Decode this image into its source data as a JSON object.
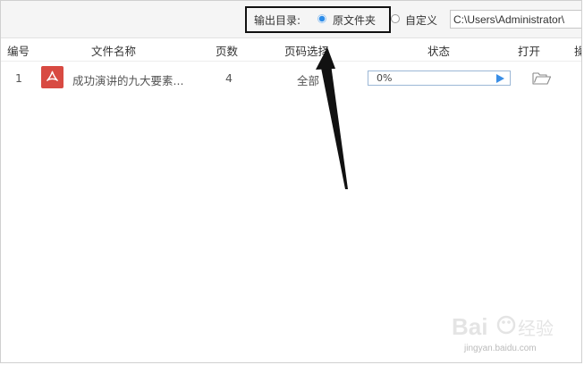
{
  "toolbar": {
    "output_label": "输出目录:",
    "option_original": "原文件夹",
    "option_custom": "自定义",
    "path_value": "C:\\Users\\Administrator\\"
  },
  "table": {
    "headers": [
      "编号",
      "文件名称",
      "页数",
      "页码选择",
      "状态",
      "打开",
      "操"
    ],
    "rows": [
      {
        "index": "1",
        "file_name": "成功演讲的九大要素...",
        "pages": "4",
        "page_selection": "全部",
        "progress_text": "0%",
        "progress_fraction": 0
      }
    ]
  },
  "watermark": {
    "brand": "Bai",
    "brand_cn": "经验",
    "url": "jingyan.baidu.com"
  },
  "colors": {
    "accent": "#2d8ce8",
    "pdf_red": "#d84a42",
    "toolbar_bg": "#f5f5f5"
  }
}
